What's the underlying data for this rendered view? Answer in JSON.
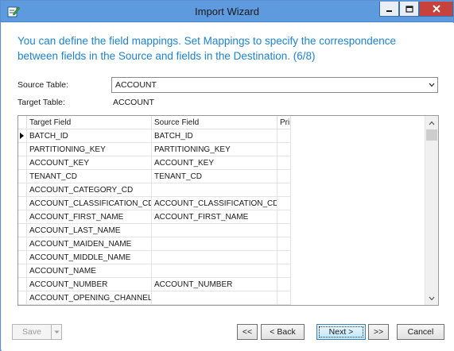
{
  "window": {
    "title": "Import Wizard",
    "app_icon": "wizard-edit-icon",
    "controls": {
      "minimize": "minimize-icon",
      "maximize": "maximize-icon",
      "close": "close-icon"
    }
  },
  "heading": "You can define the field mappings. Set Mappings to specify the correspondence between fields in the Source and fields in the Destination. (6/8)",
  "source_table": {
    "label": "Source Table:",
    "value": "ACCOUNT"
  },
  "target_table": {
    "label": "Target Table:",
    "value": "ACCOUNT"
  },
  "grid": {
    "columns": [
      "Target Field",
      "Source Field",
      "Pri"
    ],
    "rows": [
      {
        "target": "BATCH_ID",
        "source": "BATCH_ID",
        "current": true
      },
      {
        "target": "PARTITIONING_KEY",
        "source": "PARTITIONING_KEY"
      },
      {
        "target": "ACCOUNT_KEY",
        "source": "ACCOUNT_KEY"
      },
      {
        "target": "TENANT_CD",
        "source": "TENANT_CD"
      },
      {
        "target": "ACCOUNT_CATEGORY_CD",
        "source": ""
      },
      {
        "target": "ACCOUNT_CLASSIFICATION_CD",
        "source": "ACCOUNT_CLASSIFICATION_CD"
      },
      {
        "target": "ACCOUNT_FIRST_NAME",
        "source": "ACCOUNT_FIRST_NAME"
      },
      {
        "target": "ACCOUNT_LAST_NAME",
        "source": ""
      },
      {
        "target": "ACCOUNT_MAIDEN_NAME",
        "source": ""
      },
      {
        "target": "ACCOUNT_MIDDLE_NAME",
        "source": ""
      },
      {
        "target": "ACCOUNT_NAME",
        "source": ""
      },
      {
        "target": "ACCOUNT_NUMBER",
        "source": "ACCOUNT_NUMBER"
      },
      {
        "target": "ACCOUNT_OPENING_CHANNEL_",
        "source": ""
      }
    ]
  },
  "buttons": {
    "save": "Save",
    "first": "<<",
    "back": "< Back",
    "next": "Next >",
    "last": ">>",
    "cancel": "Cancel"
  },
  "colors": {
    "titlebar": "#5d9ade",
    "heading": "#1f83cf",
    "close": "#c7423c"
  }
}
